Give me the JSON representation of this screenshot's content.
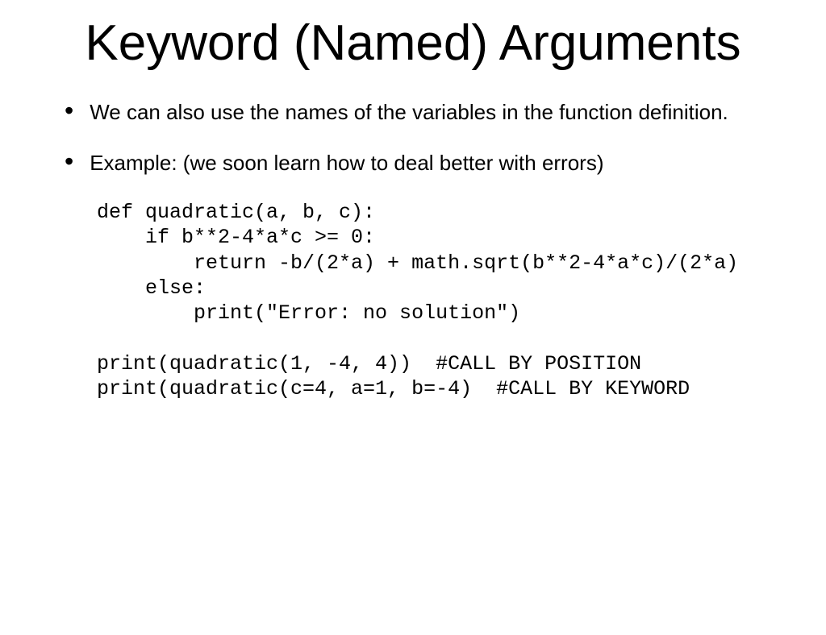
{
  "title": "Keyword (Named) Arguments",
  "bullets": [
    "We can also use the names of the variables in the function definition.",
    "Example:  (we soon learn how to deal better with errors)"
  ],
  "code": "def quadratic(a, b, c):\n    if b**2-4*a*c >= 0:\n        return -b/(2*a) + math.sqrt(b**2-4*a*c)/(2*a)\n    else:\n        print(\"Error: no solution\")\n\nprint(quadratic(1, -4, 4))  #CALL BY POSITION\nprint(quadratic(c=4, a=1, b=-4)  #CALL BY KEYWORD"
}
